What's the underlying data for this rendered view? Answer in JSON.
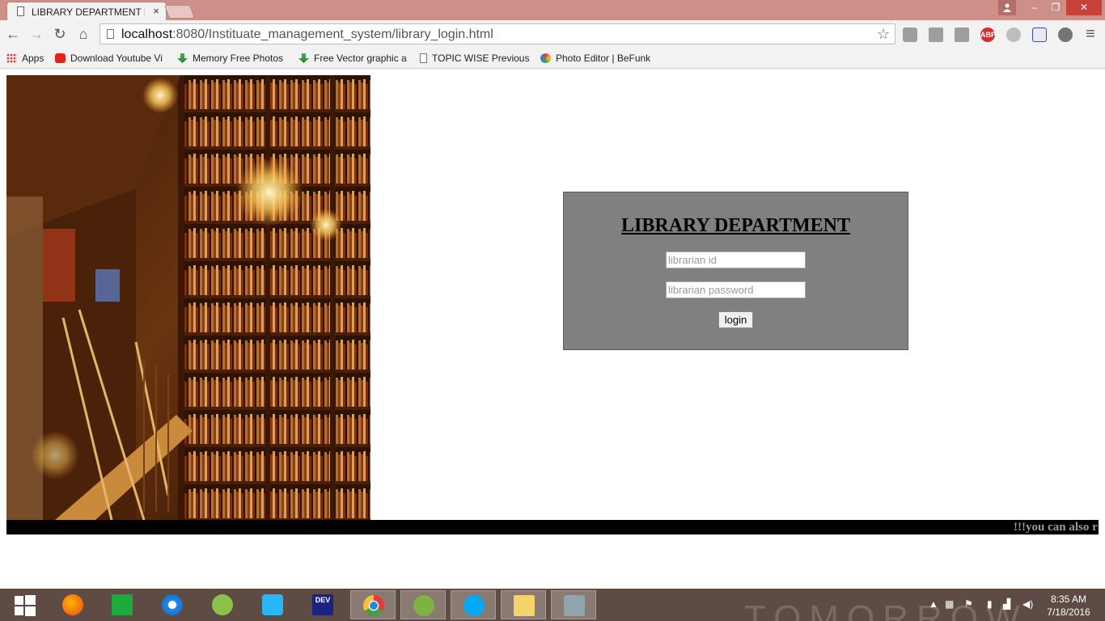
{
  "window": {
    "tab_title": "LIBRARY DEPARTMENT LC",
    "tab_close": "×",
    "controls": {
      "minimize": "‒",
      "maximize": "❐",
      "close": "✕"
    }
  },
  "toolbar": {
    "url_host": "localhost",
    "url_rest": ":8080/Instituate_management_system/library_login.html",
    "back": "←",
    "forward": "→",
    "reload": "↻",
    "home": "⌂",
    "star": "☆",
    "menu": "≡"
  },
  "extensions": [
    "office-icon",
    "puzzle-icon",
    "puzzle-icon",
    "adblock-plus-icon",
    "circle-icon",
    "gmail-icon",
    "media-icon"
  ],
  "extension_labels": {
    "abp": "ABP"
  },
  "bookmarks": [
    {
      "label": "Apps",
      "icon": "apps-grid-icon"
    },
    {
      "label": "Download Youtube Vi",
      "icon": "youtube-icon"
    },
    {
      "label": "Memory Free Photos",
      "icon": "download-arrow-icon"
    },
    {
      "label": "Free Vector graphic a",
      "icon": "download-arrow-icon"
    },
    {
      "label": "TOPIC WISE Previous",
      "icon": "page-icon"
    },
    {
      "label": "Photo Editor | BeFunk",
      "icon": "befunky-icon"
    }
  ],
  "login": {
    "title": "LIBRARY DEPARTMENT",
    "id_placeholder": "librarian id",
    "password_placeholder": "librarian password",
    "button": "login"
  },
  "marquee": {
    "text": "!!!you can also r"
  },
  "taskbar": {
    "background_text": "TOMORROW",
    "apps": [
      "firefox-icon",
      "store-icon",
      "ie-icon",
      "android-studio-icon",
      "sync-icon",
      "devcpp-icon",
      "chrome-icon",
      "utorrent-icon",
      "skype-icon",
      "folder-icon",
      "virtualbox-icon"
    ],
    "devcpp_label": "DEV",
    "time": "8:35 AM",
    "date": "7/18/2016"
  },
  "colors": {
    "titlebar": "#cd8f88",
    "login_box": "#808080",
    "marquee_bg": "#000000",
    "taskbar": "#5d4b44"
  }
}
